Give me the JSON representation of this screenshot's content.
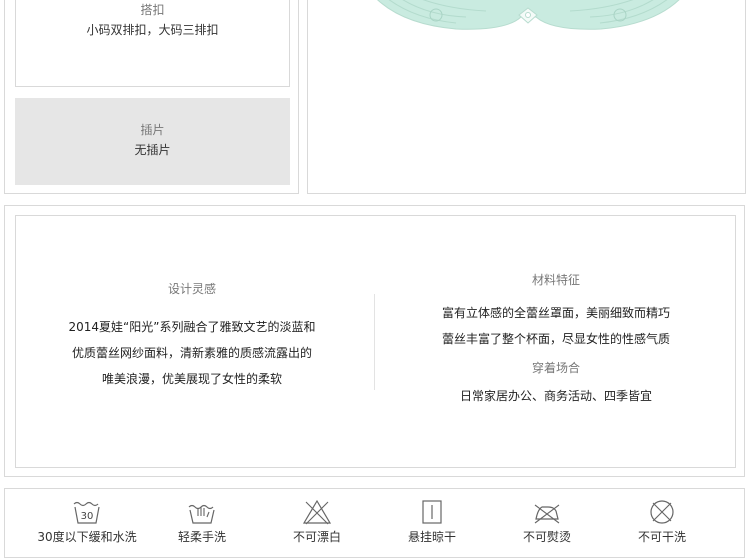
{
  "attributes": {
    "buckle": {
      "label": "搭扣",
      "value": "小码双排扣，大码三排扣"
    },
    "insert": {
      "label": "插片",
      "value": "无插片"
    }
  },
  "design": {
    "title": "设计灵感",
    "lines": [
      "2014夏娃“阳光”系列融合了雅致文艺的淡蓝和",
      "优质蕾丝网纱面料，清新素雅的质感流露出的",
      "唯美浪漫，优美展现了女性的柔软"
    ]
  },
  "material": {
    "title": "材料特征",
    "lines": [
      "富有立体感的全蕾丝罩面，美丽细致而精巧",
      "蕾丝丰富了整个杯面，尽显女性的性感气质"
    ]
  },
  "occasion": {
    "title": "穿着场合",
    "value": "日常家居办公、商务活动、四季皆宜"
  },
  "care": [
    {
      "icon": "wash-30-icon",
      "label": "30度以下缓和水洗"
    },
    {
      "icon": "hand-wash-icon",
      "label": "轻柔手洗"
    },
    {
      "icon": "no-bleach-icon",
      "label": "不可漂白"
    },
    {
      "icon": "hang-dry-icon",
      "label": "悬挂晾干"
    },
    {
      "icon": "no-iron-icon",
      "label": "不可熨烫"
    },
    {
      "icon": "no-tumble-dry-icon",
      "label": "不可干洗"
    }
  ],
  "colors": {
    "border": "#d9d9d9",
    "grey_box": "#e6e6e6",
    "product_mint": "#c9ebe0"
  }
}
